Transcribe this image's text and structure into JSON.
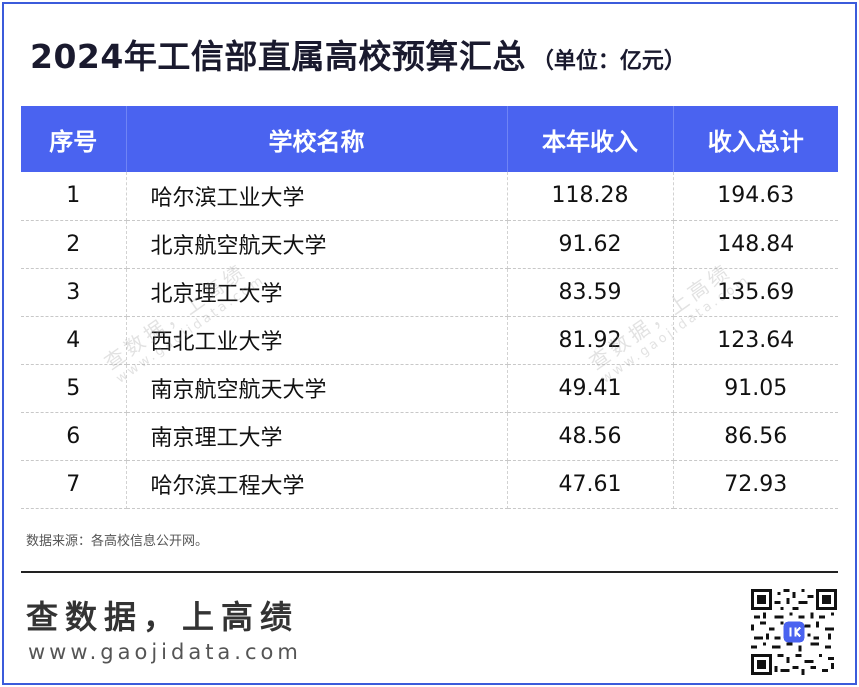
{
  "title": {
    "main": "2024年工信部直属高校预算汇总",
    "unit": "（单位：亿元）"
  },
  "table": {
    "headers": [
      "序号",
      "学校名称",
      "本年收入",
      "收入总计"
    ],
    "rows": [
      [
        "1",
        "哈尔滨工业大学",
        "118.28",
        "194.63"
      ],
      [
        "2",
        "北京航空航天大学",
        "91.62",
        "148.84"
      ],
      [
        "3",
        "北京理工大学",
        "83.59",
        "135.69"
      ],
      [
        "4",
        "西北工业大学",
        "81.92",
        "123.64"
      ],
      [
        "5",
        "南京航空航天大学",
        "49.41",
        "91.05"
      ],
      [
        "6",
        "南京理工大学",
        "48.56",
        "86.56"
      ],
      [
        "7",
        "哈尔滨工程大学",
        "47.61",
        "72.93"
      ]
    ]
  },
  "watermark": {
    "text": "查数据，上高绩",
    "site": "www.gaojidata.com"
  },
  "source": "数据来源：各高校信息公开网。",
  "footer": {
    "brand": "查数据，上高绩",
    "site": "www.gaojidata.com"
  },
  "colors": {
    "header_bg": "#4a63f0",
    "frame": "#3b5bdb"
  },
  "icons": {
    "qr": "qr-code-icon"
  }
}
